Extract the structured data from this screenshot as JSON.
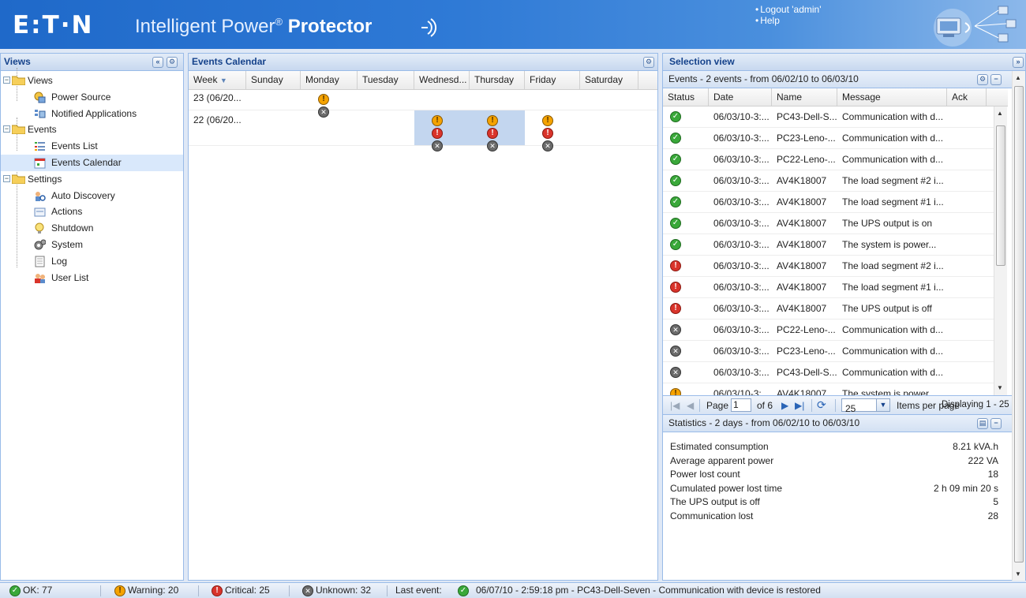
{
  "header": {
    "logo": "E:T·N",
    "title_prefix": "Intelligent Power",
    "title_reg": "®",
    "title_strong": "Protector",
    "logout": "Logout 'admin'",
    "help": "Help"
  },
  "views_panel": {
    "title": "Views",
    "tree": {
      "views": "Views",
      "power_source": "Power Source",
      "notified_applications": "Notified Applications",
      "events": "Events",
      "events_list": "Events List",
      "events_calendar": "Events Calendar",
      "settings": "Settings",
      "auto_discovery": "Auto Discovery",
      "actions": "Actions",
      "shutdown": "Shutdown",
      "system": "System",
      "log": "Log",
      "user_list": "User List"
    }
  },
  "calendar": {
    "title": "Events Calendar",
    "columns": [
      "Week",
      "Sunday",
      "Monday",
      "Tuesday",
      "Wednesd...",
      "Thursday",
      "Friday",
      "Saturday"
    ],
    "rows": [
      {
        "week": "23 (06/20...",
        "monday": [
          "warning",
          "unknown"
        ]
      },
      {
        "week": "22 (06/20...",
        "wednesday": [
          "warning",
          "critical",
          "unknown"
        ],
        "thursday": [
          "warning",
          "critical",
          "unknown"
        ],
        "friday": [
          "warning",
          "critical",
          "unknown"
        ]
      }
    ]
  },
  "selection": {
    "title": "Selection view",
    "events_header": "Events - 2 events - from 06/02/10 to 06/03/10",
    "columns": {
      "status": "Status",
      "date": "Date",
      "name": "Name",
      "message": "Message",
      "ack": "Ack"
    },
    "rows": [
      {
        "status": "ok",
        "date": "06/03/10-3:...",
        "name": "PC43-Dell-S...",
        "message": "Communication with d..."
      },
      {
        "status": "ok",
        "date": "06/03/10-3:...",
        "name": "PC23-Leno-...",
        "message": "Communication with d..."
      },
      {
        "status": "ok",
        "date": "06/03/10-3:...",
        "name": "PC22-Leno-...",
        "message": "Communication with d..."
      },
      {
        "status": "ok",
        "date": "06/03/10-3:...",
        "name": "AV4K18007",
        "message": "The load segment #2 i..."
      },
      {
        "status": "ok",
        "date": "06/03/10-3:...",
        "name": "AV4K18007",
        "message": "The load segment #1 i..."
      },
      {
        "status": "ok",
        "date": "06/03/10-3:...",
        "name": "AV4K18007",
        "message": "The UPS output is on"
      },
      {
        "status": "ok",
        "date": "06/03/10-3:...",
        "name": "AV4K18007",
        "message": "The system is power..."
      },
      {
        "status": "critical",
        "date": "06/03/10-3:...",
        "name": "AV4K18007",
        "message": "The load segment #2 i..."
      },
      {
        "status": "critical",
        "date": "06/03/10-3:...",
        "name": "AV4K18007",
        "message": "The load segment #1 i..."
      },
      {
        "status": "critical",
        "date": "06/03/10-3:...",
        "name": "AV4K18007",
        "message": "The UPS output is off"
      },
      {
        "status": "unknown",
        "date": "06/03/10-3:...",
        "name": "PC22-Leno-...",
        "message": "Communication with d..."
      },
      {
        "status": "unknown",
        "date": "06/03/10-3:...",
        "name": "PC23-Leno-...",
        "message": "Communication with d..."
      },
      {
        "status": "unknown",
        "date": "06/03/10-3:...",
        "name": "PC43-Dell-S...",
        "message": "Communication with d..."
      },
      {
        "status": "warning",
        "date": "06/03/10-3:",
        "name": "AV4K18007",
        "message": "The system is power"
      }
    ],
    "pager": {
      "page_label": "Page",
      "page_value": "1",
      "of": "of 6",
      "page_size": "25",
      "items_per_page": "Items per page",
      "displaying": "Displaying 1 - 25"
    },
    "stats_header": "Statistics - 2 days - from 06/02/10 to 06/03/10",
    "stats": [
      {
        "label": "Estimated consumption",
        "value": "8.21 kVA.h"
      },
      {
        "label": "Average apparent power",
        "value": "222 VA"
      },
      {
        "label": "Power lost count",
        "value": "18"
      },
      {
        "label": "Cumulated power lost time",
        "value": "2 h 09 min 20 s"
      },
      {
        "label": "The UPS output is off",
        "value": "5"
      },
      {
        "label": "Communication lost",
        "value": "28"
      }
    ]
  },
  "statusbar": {
    "ok": "OK: 77",
    "warning": "Warning: 20",
    "critical": "Critical: 25",
    "unknown": "Unknown: 32",
    "last_event_label": "Last event:",
    "last_event_text": "06/07/10 - 2:59:18 pm - PC43-Dell-Seven - Communication with device is restored"
  },
  "colors": {
    "ok": "#3aa83a",
    "warning": "#f5a300",
    "critical": "#d9342b",
    "unknown": "#6b6b6b",
    "header_blue": "#2f7ad6"
  }
}
